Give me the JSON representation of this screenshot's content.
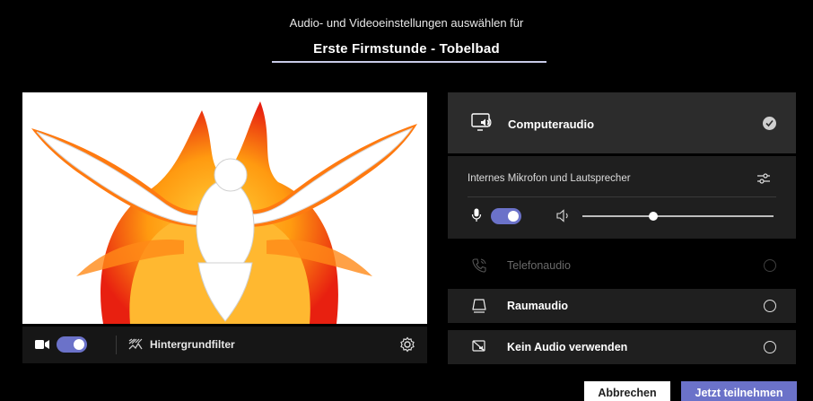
{
  "header": {
    "subtitle": "Audio- und Videoeinstellungen auswählen für",
    "meeting_title": "Erste Firmstunde - Tobelbad"
  },
  "video": {
    "preview_alt": "phoenix-dove-image",
    "camera_toggle_on": true,
    "background_filter_label": "Hintergrundfilter"
  },
  "audio_options": {
    "computer": {
      "label": "Computeraudio",
      "selected": true,
      "icon": "monitor-speaker-icon"
    },
    "device": {
      "label": "Internes Mikrofon und Lautsprecher",
      "mic_on": true,
      "speaker_volume": 0.37
    },
    "phone": {
      "label": "Telefonaudio",
      "selected": false,
      "disabled": true,
      "icon": "phone-icon"
    },
    "room": {
      "label": "Raumaudio",
      "selected": false,
      "icon": "room-device-icon"
    },
    "none": {
      "label": "Kein Audio verwenden",
      "selected": false,
      "icon": "no-audio-icon"
    }
  },
  "actions": {
    "cancel_label": "Abbrechen",
    "join_label": "Jetzt teilnehmen"
  },
  "colors": {
    "accent": "#6b72c9",
    "background": "#000000",
    "panel": "#1f1f1f",
    "panel_selected": "#2c2c2c"
  }
}
